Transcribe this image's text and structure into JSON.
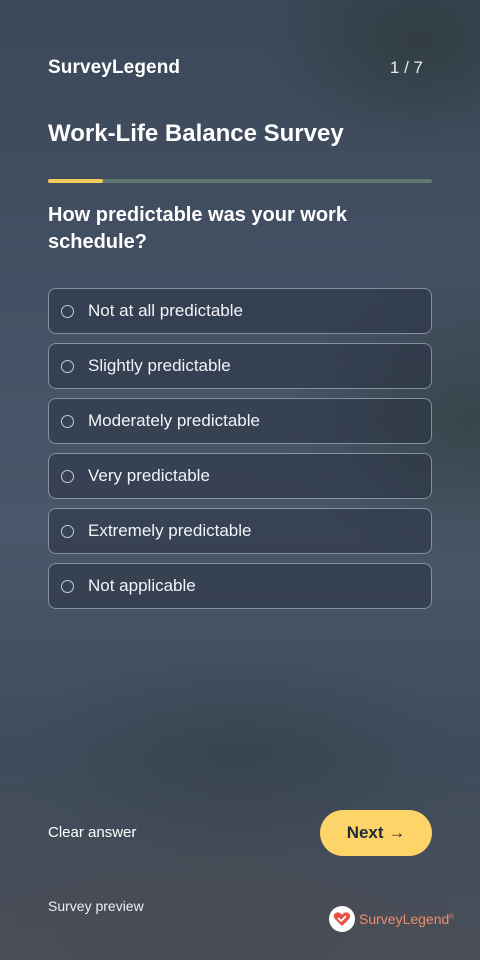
{
  "header": {
    "brand": "SurveyLegend",
    "page_indicator": "1 / 7"
  },
  "survey": {
    "title": "Work-Life Balance Survey",
    "progress_fraction": 0.143
  },
  "question": {
    "text": "How predictable was your work schedule?",
    "options": [
      {
        "label": "Not at all predictable"
      },
      {
        "label": "Slightly predictable"
      },
      {
        "label": "Moderately predictable"
      },
      {
        "label": "Very predictable"
      },
      {
        "label": "Extremely predictable"
      },
      {
        "label": "Not applicable"
      }
    ]
  },
  "actions": {
    "clear_label": "Clear answer",
    "next_label": "Next →"
  },
  "footer": {
    "note": "Survey preview",
    "logo_text": "SurveyLegend",
    "logo_mark": "®"
  },
  "colors": {
    "accent": "#fcd467",
    "progress_fill": "#f5c95a",
    "progress_track": "#5f7a72",
    "logo": "#f08c6a"
  },
  "icons": {
    "logo": "heart-check-icon",
    "option_radio": "radio-empty-icon"
  }
}
